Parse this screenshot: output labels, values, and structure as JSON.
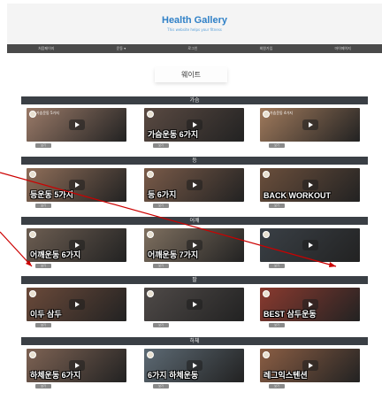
{
  "header": {
    "title": "Health Gallery",
    "subtitle": "This website helps your fitness"
  },
  "nav": [
    "처음페이지",
    "운동 ▾",
    "로그인",
    "회원가입",
    "마이페이지"
  ],
  "page": {
    "title": "웨이트"
  },
  "sections": [
    {
      "label": "가슴",
      "videos": [
        {
          "title": "가슴운동 5가지",
          "caption": "",
          "bg": "#9a7a68"
        },
        {
          "title": "",
          "caption": "가슴운동 6가지",
          "bg": "#5a4a42"
        },
        {
          "title": "가슴운동 4가지",
          "caption": "",
          "bg": "#a07a5c"
        }
      ]
    },
    {
      "label": "등",
      "videos": [
        {
          "title": "",
          "caption": "등운동 5가지",
          "bg": "#8f6e59"
        },
        {
          "title": "",
          "caption": "등 6가지",
          "bg": "#7a5b49"
        },
        {
          "title": "",
          "caption": "BACK WORKOUT",
          "bg": "#6b4f3c"
        }
      ]
    },
    {
      "label": "어깨",
      "videos": [
        {
          "title": "",
          "caption": "어깨운동 6가지",
          "bg": "#6d5e52"
        },
        {
          "title": "",
          "caption": "어깨운동 7가지",
          "bg": "#7f7060"
        },
        {
          "title": "",
          "caption": "",
          "bg": "#3a4046"
        }
      ]
    },
    {
      "label": "팔",
      "videos": [
        {
          "title": "",
          "caption": "이두 삼두",
          "bg": "#6b4a3a"
        },
        {
          "title": "",
          "caption": "",
          "bg": "#4f4a48"
        },
        {
          "title": "",
          "caption": "BEST 삼두운동",
          "bg": "#8a3a2f"
        }
      ]
    },
    {
      "label": "하체",
      "videos": [
        {
          "title": "",
          "caption": "하체운동 6가지",
          "bg": "#7e6354"
        },
        {
          "title": "",
          "caption": "6가지 하체운동",
          "bg": "#5d6a74"
        },
        {
          "title": "",
          "caption": "레그익스텐션",
          "bg": "#8b5e44"
        }
      ]
    }
  ],
  "button_label": "보기",
  "colors": {
    "brand": "#2f80c7",
    "nav_bg": "#4a4a4a",
    "section_bar": "#3a3f45",
    "annotation": "#cc0000"
  }
}
